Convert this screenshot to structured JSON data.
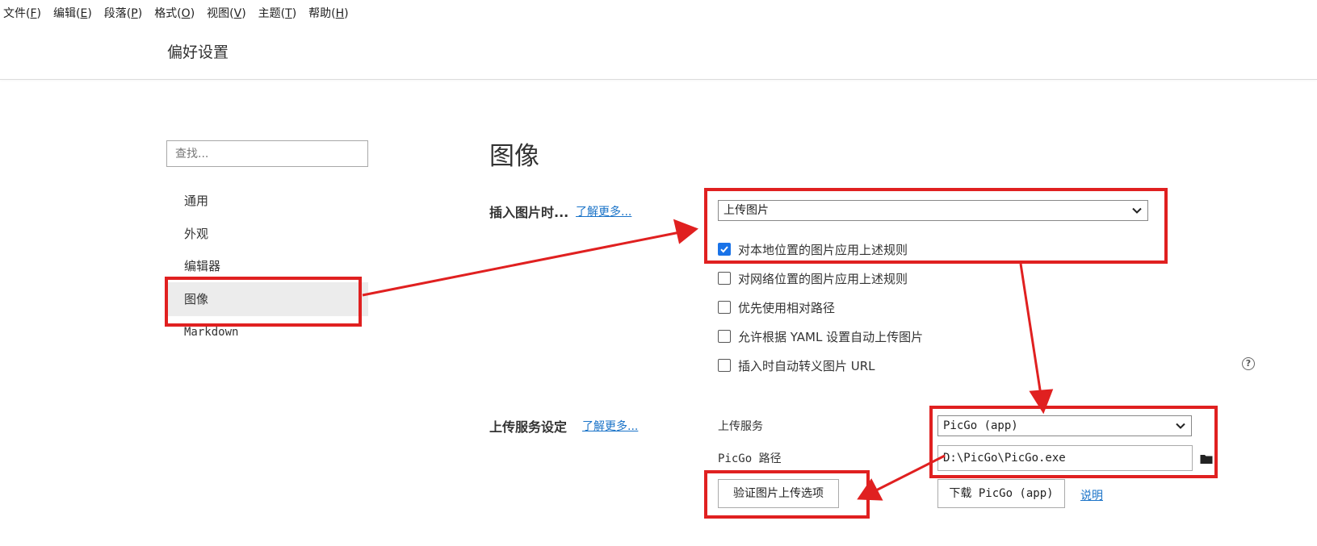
{
  "menubar": {
    "items": [
      {
        "label": "文件(",
        "key": "F",
        "end": ")"
      },
      {
        "label": "编辑(",
        "key": "E",
        "end": ")"
      },
      {
        "label": "段落(",
        "key": "P",
        "end": ")"
      },
      {
        "label": "格式(",
        "key": "O",
        "end": ")"
      },
      {
        "label": "视图(",
        "key": "V",
        "end": ")"
      },
      {
        "label": "主题(",
        "key": "T",
        "end": ")"
      },
      {
        "label": "帮助(",
        "key": "H",
        "end": ")"
      }
    ]
  },
  "header": {
    "title": "偏好设置"
  },
  "sidebar": {
    "search_placeholder": "查找...",
    "items": [
      {
        "label": "通用"
      },
      {
        "label": "外观"
      },
      {
        "label": "编辑器"
      },
      {
        "label": "图像",
        "active": true
      },
      {
        "label": "Markdown"
      }
    ]
  },
  "main": {
    "title": "图像",
    "insert": {
      "label": "插入图片时...",
      "learn_more": "了解更多...",
      "select_value": "上传图片",
      "options": [
        {
          "label": "对本地位置的图片应用上述规则",
          "checked": true
        },
        {
          "label": "对网络位置的图片应用上述规则",
          "checked": false
        },
        {
          "label": "优先使用相对路径",
          "checked": false
        },
        {
          "label": "允许根据 YAML 设置自动上传图片",
          "checked": false
        },
        {
          "label": "插入时自动转义图片 URL",
          "checked": false
        }
      ]
    },
    "upload": {
      "label": "上传服务设定",
      "learn_more": "了解更多...",
      "service_label": "上传服务",
      "service_value": "PicGo (app)",
      "path_label": "PicGo 路径",
      "path_value": "D:\\PicGo\\PicGo.exe",
      "verify_button": "验证图片上传选项",
      "download_button": "下载 PicGo (app)",
      "explain_link": "说明"
    }
  },
  "colors": {
    "annotation": "#e02020",
    "link": "#1a73c8",
    "checkbox": "#1a73e8"
  },
  "icons": [
    "chevron-down-icon",
    "check-icon",
    "help-icon",
    "folder-icon"
  ]
}
